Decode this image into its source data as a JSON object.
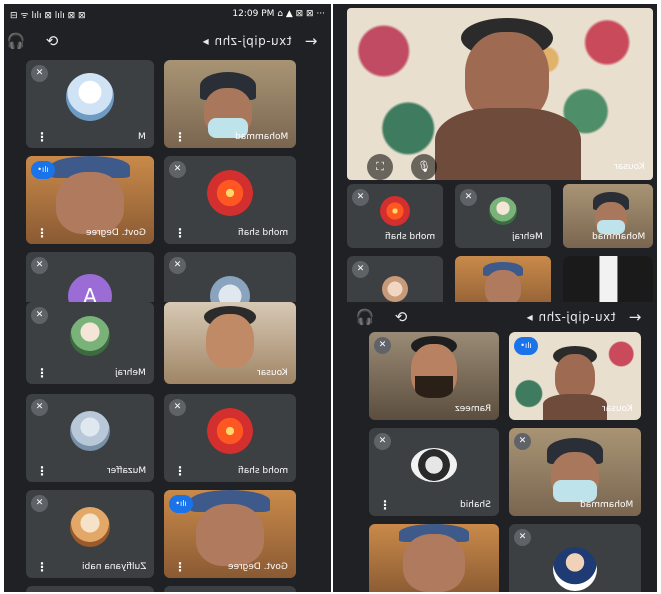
{
  "status": {
    "left": "⊟ ᯤ lılı ⊠ lılı ⊠ ⊠",
    "time": "12:09 PM ⌂ ▲ ⊠ ⊠ ···"
  },
  "tl": {
    "code": "txu-qipj-zhn",
    "tiles": [
      {
        "name": "M"
      },
      {
        "name": "Mohammad"
      },
      {
        "name": "Govt. Degree"
      },
      {
        "name": "mohd shafi"
      },
      {
        "avatar_letter": "A"
      },
      {
        "name": ""
      }
    ]
  },
  "tr": {
    "main_name": "Kousar",
    "tiles": [
      {
        "name": "mohd shafi"
      },
      {
        "name": "Mehraj"
      },
      {
        "name": "Mohammad"
      }
    ]
  },
  "bl": {
    "tiles": [
      {
        "name": "Mehraj"
      },
      {
        "name": "Kousar"
      },
      {
        "name": "Muzaffer"
      },
      {
        "name": "mohd shafi"
      },
      {
        "name": "Zulfiyana nabi"
      },
      {
        "name": "Govt. Degree"
      }
    ]
  },
  "br": {
    "code": "txu-qipj-zhn",
    "tiles": [
      {
        "name": "Rameez"
      },
      {
        "name": "Kousar"
      },
      {
        "name": "Shahid"
      },
      {
        "name": "Mohammad"
      }
    ]
  },
  "icons": {
    "headphones": "🎧",
    "flip": "⟲",
    "arrow": "→",
    "caret": "◂",
    "mic_off": "✕",
    "dots": "⋮"
  }
}
